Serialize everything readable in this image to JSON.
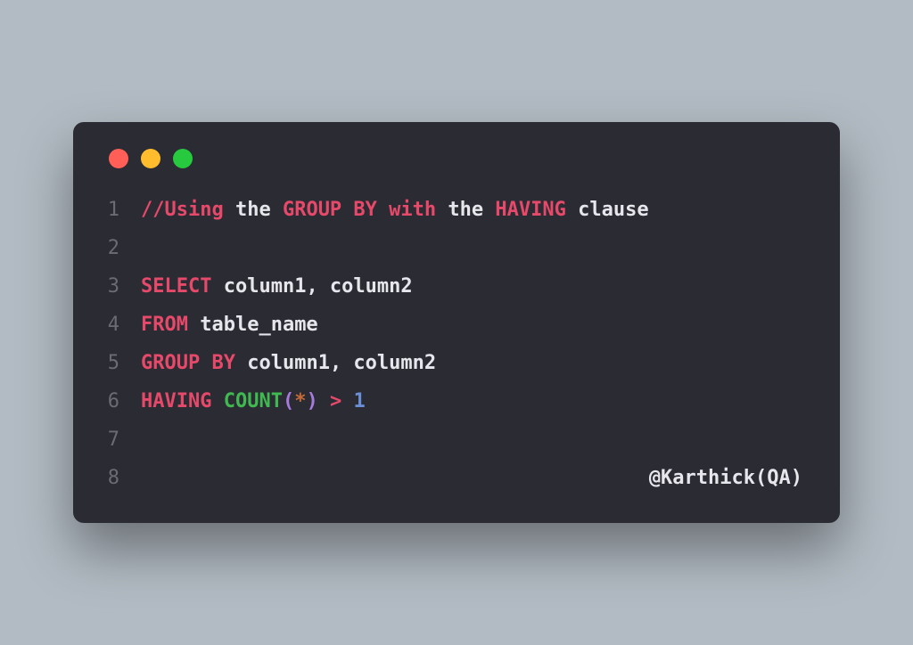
{
  "traffic_lights": {
    "red": "close",
    "yellow": "minimize",
    "green": "maximize"
  },
  "code": {
    "line_numbers": [
      "1",
      "2",
      "3",
      "4",
      "5",
      "6",
      "7",
      "8"
    ],
    "line1": {
      "slashes": "//Using",
      "the1": " the ",
      "groupby": "GROUP BY",
      "with": " with",
      "the2": " the ",
      "having": "HAVING",
      "clause": " clause"
    },
    "line3": {
      "select": "SELECT",
      "cols": " column1, column2"
    },
    "line4": {
      "from": "FROM",
      "table": " table_name"
    },
    "line5": {
      "group": "GROUP",
      "by": " BY",
      "cols": " column1, column2"
    },
    "line6": {
      "having": "HAVING ",
      "count": "COUNT",
      "lparen": "(",
      "star": "*",
      "rparen": ")",
      "sp": " ",
      "gt": ">",
      "sp2": " ",
      "one": "1"
    },
    "signature": "@Karthick(QA)"
  }
}
